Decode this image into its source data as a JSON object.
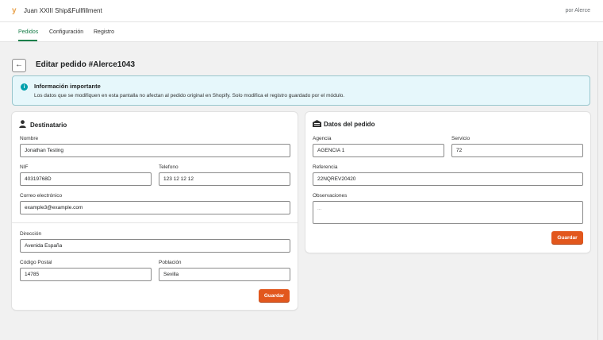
{
  "app": {
    "logo": "y",
    "title": "Juan XXIII Ship&Fullfillment",
    "by": "por Alerce"
  },
  "nav": {
    "tabs": [
      {
        "label": "Pedidos",
        "active": true
      },
      {
        "label": "Configuración",
        "active": false
      },
      {
        "label": "Registro",
        "active": false
      }
    ]
  },
  "page": {
    "back": "←",
    "title": "Editar pedido #Alerce1043"
  },
  "banner": {
    "icon": "info-icon",
    "title": "Información importante",
    "text": "Los datos que se modifiquen en esta pantalla no afectan al pedido original en Shopify. Solo modifica el registro guardado por el módulo."
  },
  "recipient": {
    "title": "Destinatario",
    "icon": "person-icon",
    "name": {
      "label": "Nombre",
      "value": "Jonathan Testing"
    },
    "nif": {
      "label": "NIF",
      "value": "40319768D"
    },
    "phone": {
      "label": "Telefono",
      "value": "123 12 12 12"
    },
    "email": {
      "label": "Correo electrónico",
      "value": "example3@example.com"
    },
    "address": {
      "label": "Dirección",
      "value": "Avenida España"
    },
    "postal": {
      "label": "Código Postal",
      "value": "14785"
    },
    "city": {
      "label": "Población",
      "value": "Sevilla"
    },
    "save": "Guardar"
  },
  "order": {
    "title": "Datos del pedido",
    "icon": "warehouse-icon",
    "agency": {
      "label": "Agencia",
      "value": "AGENCIA 1"
    },
    "service": {
      "label": "Servicio",
      "value": "72"
    },
    "reference": {
      "label": "Referencia",
      "value": "22NQREV20420"
    },
    "notes": {
      "label": "Observaciones",
      "placeholder": "..."
    },
    "save": "Guardar"
  },
  "colors": {
    "accent": "#1a7f4b",
    "primary_button": "#e2571d",
    "banner_bg": "#e6f7fb",
    "info": "#00a0ac"
  }
}
